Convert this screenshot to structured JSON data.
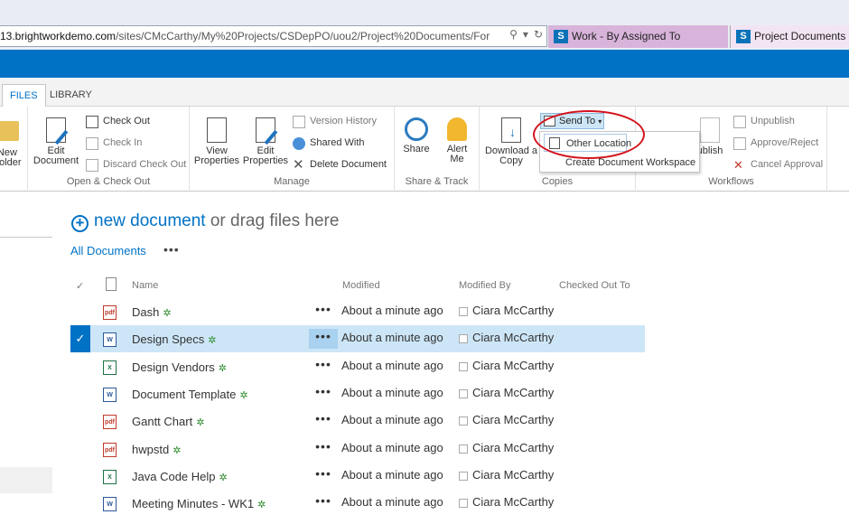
{
  "browser": {
    "address_prefix": "13.brightworkdemo.com",
    "address_path": "/sites/CMcCarthy/My%20Projects/CSDepPO/uou2/Project%20Documents/For",
    "tabs": [
      {
        "label": "Work - By Assigned To"
      },
      {
        "label": "Project Documents -"
      }
    ]
  },
  "ribbon": {
    "tabs": [
      {
        "label": "FILES",
        "active": true
      },
      {
        "label": "LIBRARY",
        "active": false
      }
    ],
    "new_folder_partial": "New\nFolder",
    "groups": {
      "open_checkout": {
        "label": "Open & Check Out",
        "edit_document": "Edit\nDocument",
        "check_out": "Check Out",
        "check_in": "Check In",
        "discard_check_out": "Discard Check Out"
      },
      "manage": {
        "label": "Manage",
        "view_properties": "View\nProperties",
        "edit_properties": "Edit\nProperties",
        "version_history": "Version History",
        "shared_with": "Shared With",
        "delete_document": "Delete Document"
      },
      "share_track": {
        "label": "Share & Track",
        "share": "Share",
        "alert_me": "Alert\nMe"
      },
      "copies": {
        "label": "Copies",
        "download_copy": "Download a\nCopy",
        "send_to": "Send To",
        "send_to_menu": [
          "Other Location",
          "Create Document Workspace"
        ]
      },
      "workflows": {
        "label": "Workflows",
        "publish_partial": "ublish",
        "unpublish": "Unpublish",
        "approve_reject": "Approve/Reject",
        "cancel_approval": "Cancel Approval"
      }
    }
  },
  "main": {
    "new_document": "new document",
    "drag_text": "or drag files here",
    "view_name": "All Documents",
    "columns": {
      "name": "Name",
      "modified": "Modified",
      "modified_by": "Modified By",
      "checked_out_to": "Checked Out To"
    },
    "rows": [
      {
        "name": "Dash",
        "type": "pdf",
        "modified": "About a minute ago",
        "by": "Ciara McCarthy",
        "selected": false
      },
      {
        "name": "Design Specs",
        "type": "word",
        "modified": "About a minute ago",
        "by": "Ciara McCarthy",
        "selected": true
      },
      {
        "name": "Design Vendors",
        "type": "excel",
        "modified": "About a minute ago",
        "by": "Ciara McCarthy",
        "selected": false
      },
      {
        "name": "Document Template",
        "type": "word",
        "modified": "About a minute ago",
        "by": "Ciara McCarthy",
        "selected": false
      },
      {
        "name": "Gantt Chart",
        "type": "pdf",
        "modified": "About a minute ago",
        "by": "Ciara McCarthy",
        "selected": false
      },
      {
        "name": "hwpstd",
        "type": "pdf",
        "modified": "About a minute ago",
        "by": "Ciara McCarthy",
        "selected": false
      },
      {
        "name": "Java Code Help",
        "type": "excel",
        "modified": "About a minute ago",
        "by": "Ciara McCarthy",
        "selected": false
      },
      {
        "name": "Meeting Minutes - WK1",
        "type": "word",
        "modified": "About a minute ago",
        "by": "Ciara McCarthy",
        "selected": false
      }
    ]
  },
  "colors": {
    "accent": "#0072c6",
    "selection": "#cde6f7",
    "annotation": "#d4141e"
  }
}
